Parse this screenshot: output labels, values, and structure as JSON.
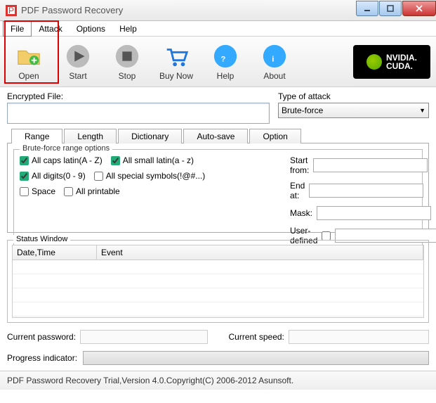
{
  "window": {
    "title": "PDF Password Recovery"
  },
  "menu": {
    "file": "File",
    "attack": "Attack",
    "options": "Options",
    "help": "Help"
  },
  "toolbar": {
    "open": "Open",
    "start": "Start",
    "stop": "Stop",
    "buynow": "Buy Now",
    "help": "Help",
    "about": "About",
    "cuda_brand": "NVIDIA.",
    "cuda_label": "CUDA."
  },
  "fields": {
    "encrypted_label": "Encrypted File:",
    "encrypted_value": "",
    "attack_type_label": "Type of attack",
    "attack_type_value": "Brute-force"
  },
  "tabs": {
    "range": "Range",
    "length": "Length",
    "dictionary": "Dictionary",
    "autosave": "Auto-save",
    "option": "Option"
  },
  "bruteforce": {
    "legend": "Brute-force range options",
    "caps": "All caps latin(A - Z)",
    "caps_checked": true,
    "small": "All small latin(a - z)",
    "small_checked": true,
    "digits": "All digits(0 - 9)",
    "digits_checked": true,
    "special": "All special symbols(!@#...)",
    "special_checked": false,
    "space": "Space",
    "space_checked": false,
    "printable": "All printable",
    "printable_checked": false,
    "start_label": "Start from:",
    "start_value": "",
    "end_label": "End at:",
    "end_value": "",
    "mask_label": "Mask:",
    "mask_value": "",
    "userdef_label": "User-defined",
    "userdef_checked": false,
    "userdef_value": ""
  },
  "status": {
    "legend": "Status Window",
    "col_datetime": "Date,Time",
    "col_event": "Event"
  },
  "bottom": {
    "curpass_label": "Current password:",
    "curpass_value": "",
    "curspeed_label": "Current speed:",
    "curspeed_value": "",
    "progress_label": "Progress indicator:"
  },
  "footer": {
    "text": "PDF Password Recovery Trial,Version 4.0.Copyright(C) 2006-2012 Asunsoft."
  }
}
